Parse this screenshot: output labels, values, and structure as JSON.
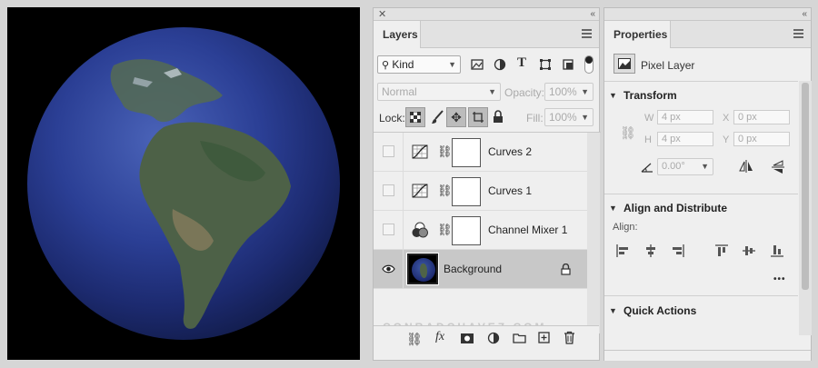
{
  "layers_panel": {
    "tab": "Layers",
    "filter_kind": "Kind",
    "blend_mode": "Normal",
    "opacity_label": "Opacity:",
    "opacity_value": "100%",
    "lock_label": "Lock:",
    "fill_label": "Fill:",
    "fill_value": "100%",
    "layers": [
      {
        "name": "Curves 2",
        "type": "curves"
      },
      {
        "name": "Curves 1",
        "type": "curves"
      },
      {
        "name": "Channel Mixer 1",
        "type": "channel-mixer"
      },
      {
        "name": "Background",
        "type": "pixel",
        "visible": true,
        "locked": true,
        "selected": true
      }
    ],
    "watermark": "CONRADCHAVEZ.COM"
  },
  "properties_panel": {
    "tab": "Properties",
    "layer_type": "Pixel Layer",
    "transform": {
      "title": "Transform",
      "w_label": "W",
      "w_value": "4 px",
      "h_label": "H",
      "h_value": "4 px",
      "x_label": "X",
      "x_value": "0 px",
      "y_label": "Y",
      "y_value": "0 px",
      "angle_value": "0.00°"
    },
    "align": {
      "title": "Align and Distribute",
      "label": "Align:",
      "more": "•••"
    },
    "quick_actions": {
      "title": "Quick Actions"
    }
  },
  "colors": {
    "panel_bg": "#efefef",
    "selected_row": "#c8c8c8",
    "document_bg": "#000000"
  }
}
